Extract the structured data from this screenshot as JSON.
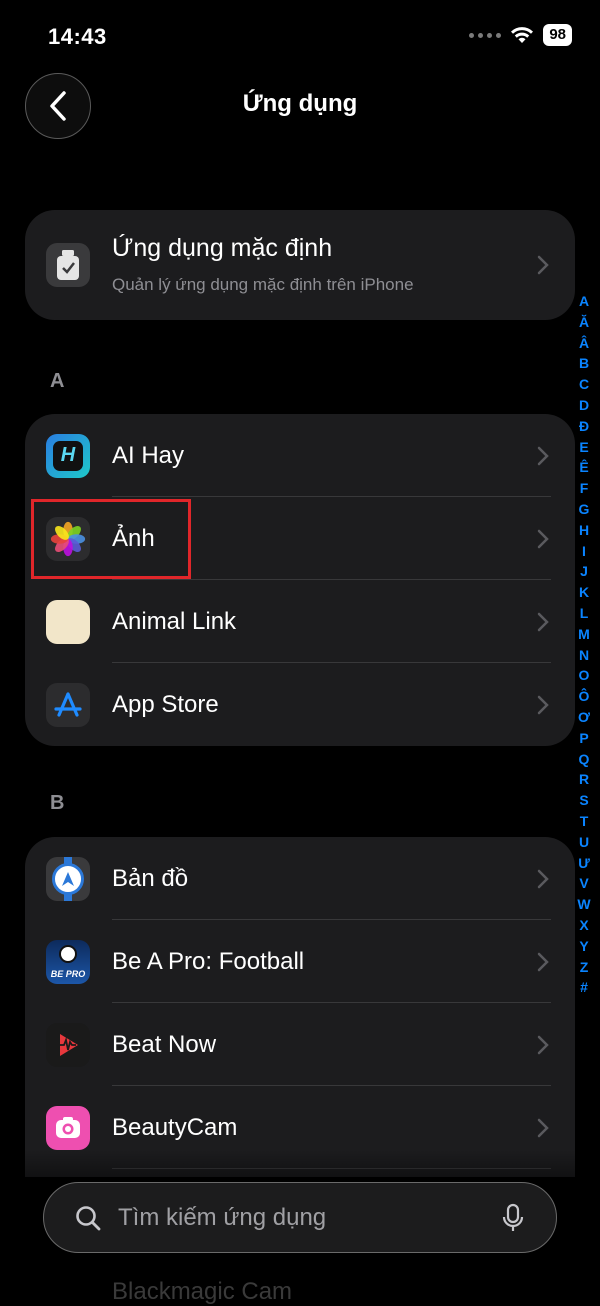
{
  "status_bar": {
    "time": "14:43",
    "battery": "98"
  },
  "nav": {
    "title": "Ứng dụng"
  },
  "default_apps": {
    "title": "Ứng dụng mặc định",
    "subtitle": "Quản lý ứng dụng mặc định trên iPhone"
  },
  "sections": [
    {
      "letter": "A",
      "items": [
        "AI Hay",
        "Ảnh",
        "Animal Link",
        "App Store"
      ]
    },
    {
      "letter": "B",
      "items": [
        "Bản đồ",
        "Be A Pro: Football",
        "Beat Now",
        "BeautyCam"
      ]
    }
  ],
  "peek_item": "Blackmagic Cam",
  "index_letters": [
    "A",
    "Ă",
    "Â",
    "B",
    "C",
    "D",
    "Đ",
    "E",
    "Ê",
    "F",
    "G",
    "H",
    "I",
    "J",
    "K",
    "L",
    "M",
    "N",
    "O",
    "Ô",
    "Ơ",
    "P",
    "Q",
    "R",
    "S",
    "T",
    "U",
    "Ư",
    "V",
    "W",
    "X",
    "Y",
    "Z",
    "#"
  ],
  "search": {
    "placeholder": "Tìm kiếm ứng dụng"
  },
  "colors": {
    "accent": "#0a84ff",
    "highlight_box": "#e0262a",
    "cell_bg": "#1c1c1e"
  }
}
